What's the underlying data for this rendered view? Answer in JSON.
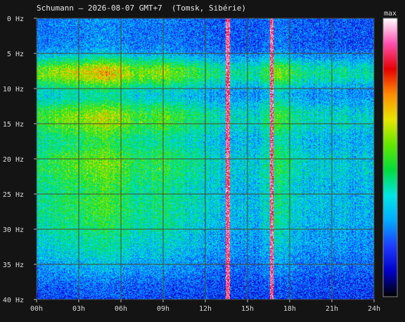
{
  "title": "Schumann — 2026-08-07 GMT+7  (Tomsk, Sibérie)",
  "chart_data": {
    "type": "heatmap",
    "title": "Schumann — 2026-08-07 GMT+7  (Tomsk, Sibérie)",
    "x_ticks": [
      "00h",
      "03h",
      "06h",
      "09h",
      "12h",
      "15h",
      "18h",
      "21h",
      "24h"
    ],
    "y_ticks": [
      "0 Hz",
      "5 Hz",
      "10 Hz",
      "15 Hz",
      "20 Hz",
      "25 Hz",
      "30 Hz",
      "35 Hz",
      "40 Hz"
    ],
    "x_range_hours": [
      0,
      24
    ],
    "y_range_hz": [
      0,
      40
    ],
    "grid": true,
    "colorbar": {
      "label": "max",
      "colors": [
        "#000000",
        "#0000c8",
        "#1e3cff",
        "#00aaff",
        "#00e6e6",
        "#00dc3c",
        "#64e600",
        "#e6e600",
        "#ff8c00",
        "#e60000",
        "#ff4fb0",
        "#ffffff"
      ]
    },
    "resonance_bands_hz": [
      7.8,
      14.1,
      20.3,
      26.4,
      32.5
    ],
    "intensity_profile": {
      "hours": [
        0,
        1,
        2,
        3,
        4,
        5,
        6,
        7,
        8,
        9,
        10,
        11,
        12,
        13,
        14,
        15,
        16,
        17,
        18,
        19,
        20,
        21,
        22,
        23,
        24
      ],
      "level": [
        0.55,
        0.62,
        0.68,
        0.72,
        0.75,
        0.8,
        0.72,
        0.6,
        0.62,
        0.65,
        0.58,
        0.5,
        0.45,
        0.4,
        0.38,
        0.38,
        0.4,
        0.62,
        0.55,
        0.42,
        0.4,
        0.38,
        0.37,
        0.36,
        0.36
      ]
    },
    "saturated_bursts_hours": [
      [
        13.45,
        13.75
      ],
      [
        16.6,
        16.85
      ]
    ]
  }
}
